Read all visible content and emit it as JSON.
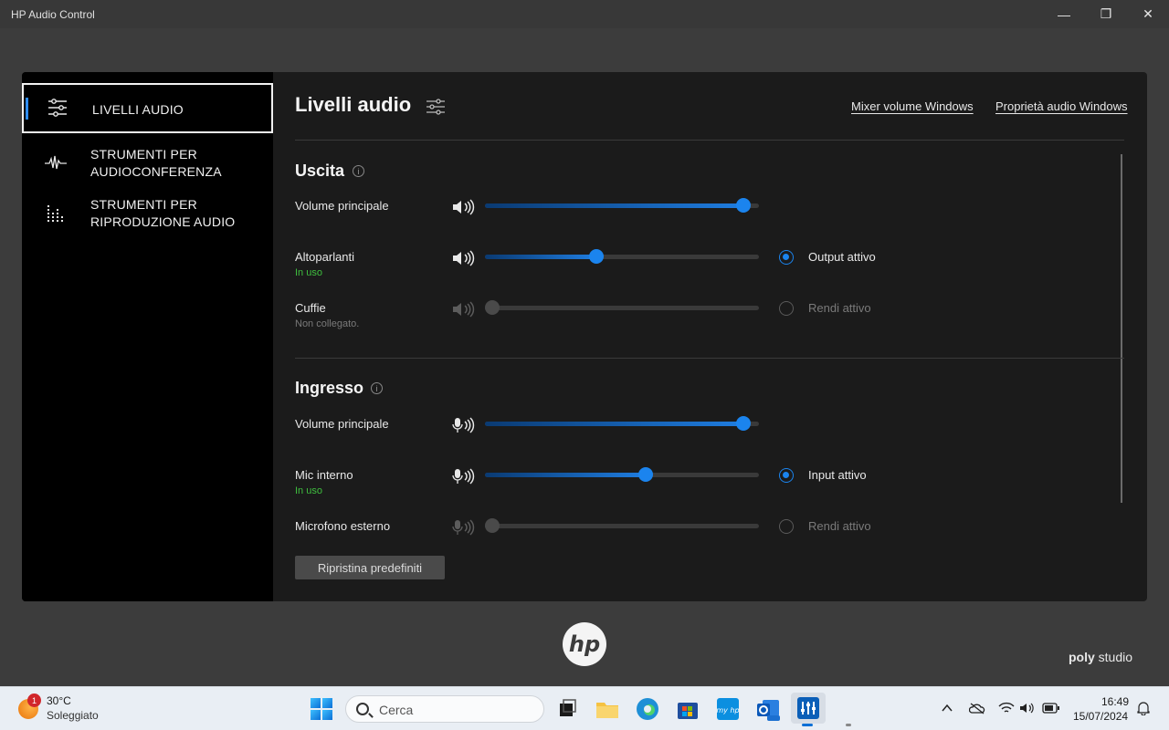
{
  "window": {
    "title": "HP Audio Control",
    "minimize": "—",
    "restore": "❐",
    "close": "✕"
  },
  "sidebar": {
    "items": [
      {
        "label": "LIVELLI AUDIO",
        "icon": "sliders-icon"
      },
      {
        "label": "STRUMENTI PER\nAUDIOCONFERENZA",
        "icon": "waveform-icon"
      },
      {
        "label": "STRUMENTI PER\nRIPRODUZIONE AUDIO",
        "icon": "equalizer-icon"
      }
    ]
  },
  "header": {
    "title": "Livelli audio",
    "link_mixer": "Mixer volume Windows",
    "link_properties": "Proprietà audio Windows"
  },
  "output": {
    "title": "Uscita",
    "rows": [
      {
        "label": "Volume principale",
        "sub": "",
        "level": 0.97,
        "enabled": true
      },
      {
        "label": "Altoparlanti",
        "sub": "In uso",
        "level": 0.4,
        "enabled": true,
        "radio": "Output attivo",
        "selected": true
      },
      {
        "label": "Cuffie",
        "sub": "Non collegato.",
        "level": 0.0,
        "enabled": false,
        "radio": "Rendi attivo",
        "selected": false
      }
    ]
  },
  "input": {
    "title": "Ingresso",
    "rows": [
      {
        "label": "Volume principale",
        "sub": "",
        "level": 0.97,
        "enabled": true
      },
      {
        "label": "Mic interno",
        "sub": "In uso",
        "level": 0.59,
        "enabled": true,
        "radio": "Input attivo",
        "selected": true
      },
      {
        "label": "Microfono esterno",
        "sub": "",
        "level": 0.0,
        "enabled": false,
        "radio": "Rendi attivo",
        "selected": false
      }
    ]
  },
  "reset_button": "Ripristina predefiniti",
  "branding": {
    "hp": "hp",
    "poly_bold": "poly",
    "poly_rest": "studio"
  },
  "taskbar": {
    "weather_badge": "1",
    "weather_temp": "30°C",
    "weather_desc": "Soleggiato",
    "search_placeholder": "Cerca",
    "clock_time": "16:49",
    "clock_date": "15/07/2024"
  }
}
